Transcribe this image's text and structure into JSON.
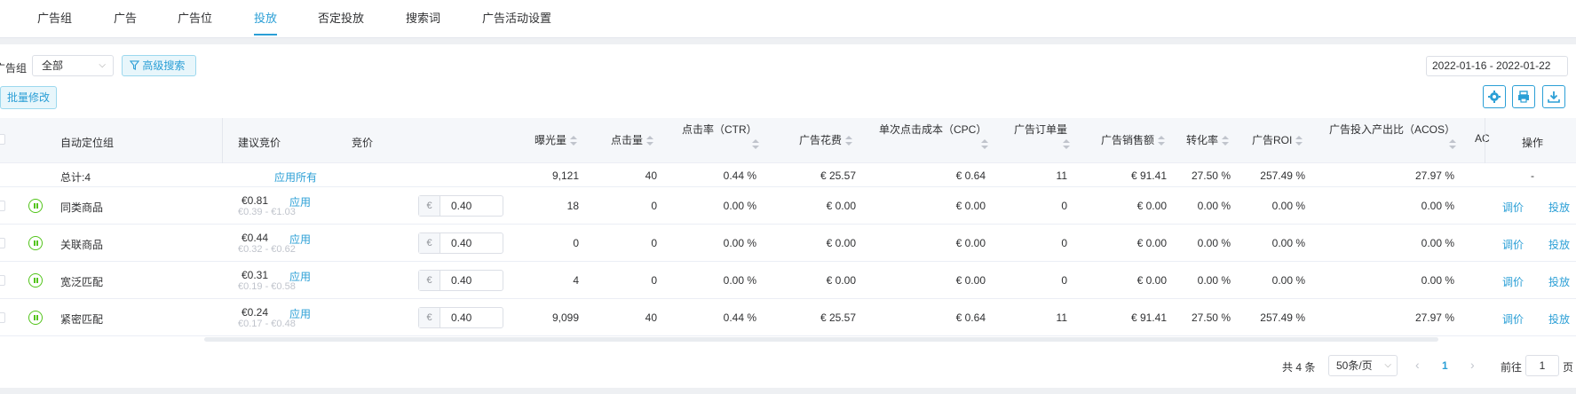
{
  "tabs": [
    {
      "label": "广告组"
    },
    {
      "label": "广告"
    },
    {
      "label": "广告位"
    },
    {
      "label": "投放"
    },
    {
      "label": "否定投放"
    },
    {
      "label": "搜索词"
    },
    {
      "label": "广告活动设置"
    }
  ],
  "active_tab": "投放",
  "accent_color": "#2b9fd6",
  "filter": {
    "label": "广告组",
    "select_value": "全部",
    "advanced_search": "高级搜索",
    "date_range": "2022-01-16 - 2022-01-22"
  },
  "toolbar": {
    "batch_edit": "批量修改",
    "icons": [
      "gear-icon",
      "print-icon",
      "download-icon"
    ]
  },
  "table": {
    "headers": {
      "group": "自动定位组",
      "suggested": "建议竞价",
      "bid": "竞价",
      "impressions": "曝光量",
      "clicks": "点击量",
      "ctr": "点击率（CTR）",
      "spend": "广告花费",
      "cpc": "单次点击成本（CPC）",
      "orders": "广告订单量",
      "sales": "广告销售额",
      "cvr": "转化率",
      "roi": "广告ROI",
      "acos": "广告投入产出比（ACOS）",
      "ac_trunc": "AC",
      "ops": "操作"
    },
    "total": {
      "label": "总计:4",
      "apply_all": "应用所有",
      "impressions": "9,121",
      "clicks": "40",
      "ctr": "0.44 %",
      "spend": "€ 25.57",
      "cpc": "€ 0.64",
      "orders": "11",
      "sales": "€ 91.41",
      "cvr": "27.50 %",
      "roi": "257.49 %",
      "acos": "27.97 %",
      "ops": "-"
    },
    "rows": [
      {
        "name": "同类商品",
        "suggested": "€0.81",
        "range": "€0.39 - €1.03",
        "apply": "应用",
        "currency": "€",
        "bid": "0.40",
        "impressions": "18",
        "clicks": "0",
        "ctr": "0.00 %",
        "spend": "€ 0.00",
        "cpc": "€ 0.00",
        "orders": "0",
        "sales": "€ 0.00",
        "cvr": "0.00 %",
        "roi": "0.00 %",
        "acos": "0.00 %",
        "op1": "调价",
        "op2": "投放"
      },
      {
        "name": "关联商品",
        "suggested": "€0.44",
        "range": "€0.32 - €0.62",
        "apply": "应用",
        "currency": "€",
        "bid": "0.40",
        "impressions": "0",
        "clicks": "0",
        "ctr": "0.00 %",
        "spend": "€ 0.00",
        "cpc": "€ 0.00",
        "orders": "0",
        "sales": "€ 0.00",
        "cvr": "0.00 %",
        "roi": "0.00 %",
        "acos": "0.00 %",
        "op1": "调价",
        "op2": "投放"
      },
      {
        "name": "宽泛匹配",
        "suggested": "€0.31",
        "range": "€0.19 - €0.58",
        "apply": "应用",
        "currency": "€",
        "bid": "0.40",
        "impressions": "4",
        "clicks": "0",
        "ctr": "0.00 %",
        "spend": "€ 0.00",
        "cpc": "€ 0.00",
        "orders": "0",
        "sales": "€ 0.00",
        "cvr": "0.00 %",
        "roi": "0.00 %",
        "acos": "0.00 %",
        "op1": "调价",
        "op2": "投放"
      },
      {
        "name": "紧密匹配",
        "suggested": "€0.24",
        "range": "€0.17 - €0.48",
        "apply": "应用",
        "currency": "€",
        "bid": "0.40",
        "impressions": "9,099",
        "clicks": "40",
        "ctr": "0.44 %",
        "spend": "€ 25.57",
        "cpc": "€ 0.64",
        "orders": "11",
        "sales": "€ 91.41",
        "cvr": "27.50 %",
        "roi": "257.49 %",
        "acos": "27.97 %",
        "op1": "调价",
        "op2": "投放"
      }
    ]
  },
  "pagination": {
    "total": "共 4 条",
    "page_size": "50条/页",
    "current": "1",
    "goto_prefix": "前往",
    "goto_value": "1",
    "goto_suffix": "页"
  }
}
